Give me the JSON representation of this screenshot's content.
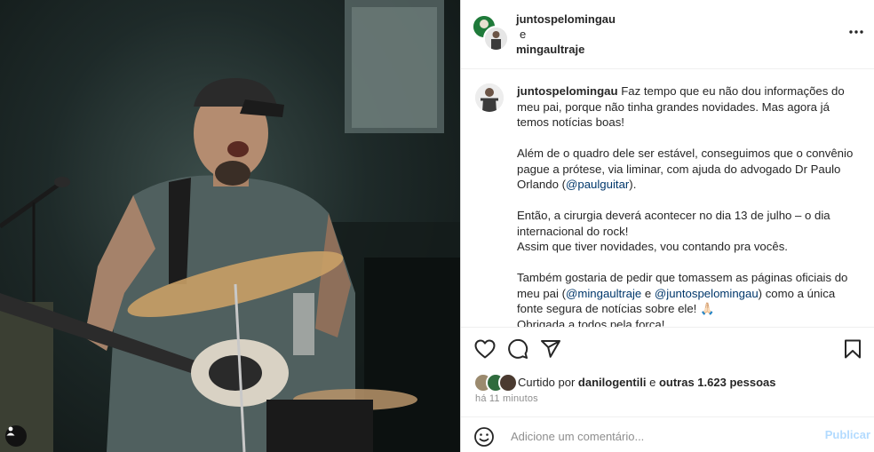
{
  "post": {
    "author_primary": "juntospelomingau",
    "collab_joiner": "e",
    "author_secondary": "mingaultraje"
  },
  "caption": {
    "username": "juntospelomingau",
    "p1": "Faz tempo que eu não dou informações do meu pai, porque não tinha grandes novidades. Mas agora já temos notícias boas!",
    "p2_before": "Além de o quadro dele ser estável, conseguimos que o convênio pague a prótese, via liminar, com ajuda do advogado Dr Paulo Orlando (",
    "p2_mention": "@paulguitar",
    "p2_after": ").",
    "p3_line1": "Então, a cirurgia deverá acontecer no dia 13 de julho – o dia internacional do rock!",
    "p3_line2": "Assim que tiver novidades, vou contando pra vocês.",
    "p4_before": "Também gostaria de pedir que tomassem as páginas oficiais do meu pai (",
    "p4_mention1": "@mingaultraje",
    "p4_mid": " e ",
    "p4_mention2": "@juntospelomingau",
    "p4_after": ") como a única fonte segura de notícias sobre ele! 🙏🏻",
    "p4_line2": "Obrigada a todos pela força!"
  },
  "likes": {
    "prefix": "Curtido por ",
    "user": "danilogentili",
    "mid": " e ",
    "others": "outras 1.623 pessoas"
  },
  "time_ago": "há 11 minutos",
  "comment": {
    "placeholder": "Adicione um comentário...",
    "publish_label": "Publicar"
  },
  "icons": {
    "more": "more-options-icon",
    "like": "heart-icon",
    "comment": "comment-icon",
    "share": "share-icon",
    "save": "bookmark-icon",
    "emoji": "emoji-icon",
    "tag": "user-tag-icon"
  },
  "colors": {
    "mention": "#00376b",
    "publish_disabled": "#b3dbff",
    "secondary_text": "#8e8e8e"
  }
}
